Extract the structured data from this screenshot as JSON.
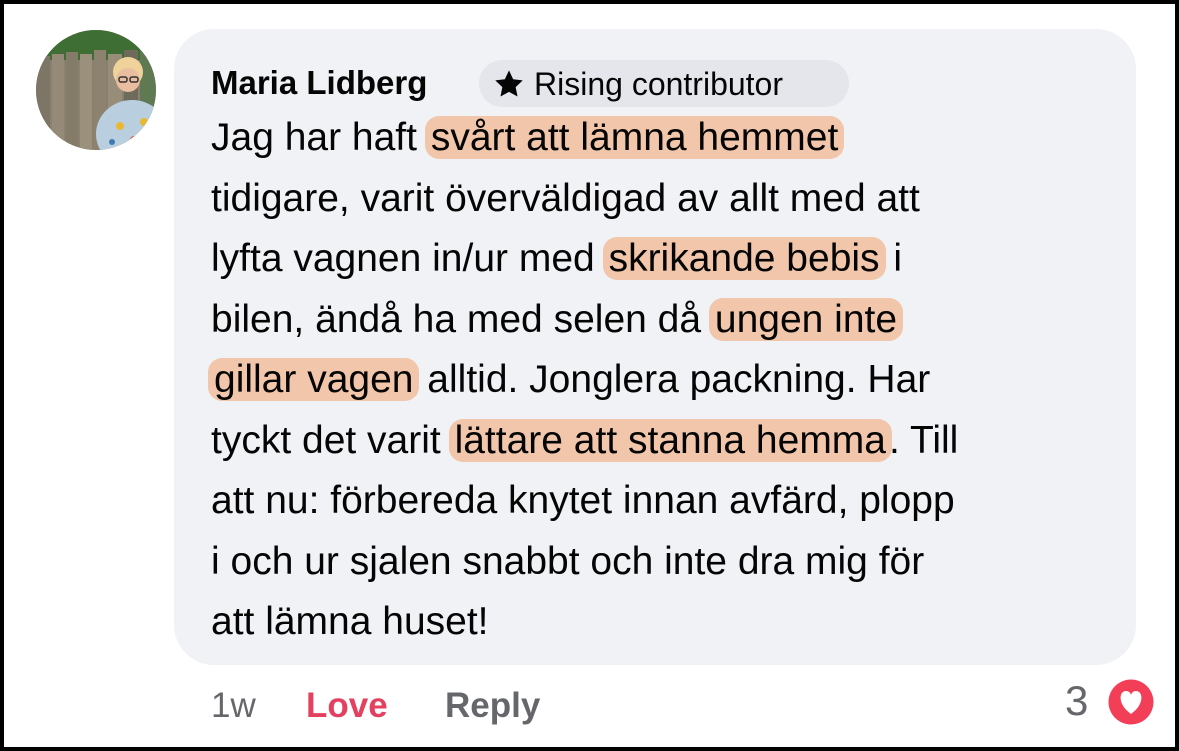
{
  "comment": {
    "author": "Maria Lidberg",
    "badge": {
      "icon": "star-icon",
      "label": "Rising contributor"
    },
    "lines": [
      {
        "segments": [
          {
            "text": "Jag har haft ",
            "highlight": false
          },
          {
            "text": "svårt att lämna hemmet",
            "highlight": true
          }
        ]
      },
      {
        "segments": [
          {
            "text": "tidigare, varit överväldigad av allt med att",
            "highlight": false
          }
        ]
      },
      {
        "segments": [
          {
            "text": "lyfta vagnen in/ur med ",
            "highlight": false
          },
          {
            "text": "skrikande bebis",
            "highlight": true
          },
          {
            "text": " i",
            "highlight": false
          }
        ]
      },
      {
        "segments": [
          {
            "text": "bilen, ändå ha med selen då ",
            "highlight": false
          },
          {
            "text": "ungen inte",
            "highlight": true
          }
        ]
      },
      {
        "segments": [
          {
            "text": "gillar vagen",
            "highlight": true
          },
          {
            "text": " alltid. Jonglera packning. Har",
            "highlight": false
          }
        ]
      },
      {
        "segments": [
          {
            "text": "tyckt det varit ",
            "highlight": false
          },
          {
            "text": "lättare att stanna hemma",
            "highlight": true
          },
          {
            "text": ". Till",
            "highlight": false
          }
        ]
      },
      {
        "segments": [
          {
            "text": "att nu: förbereda knytet innan avfärd, plopp",
            "highlight": false
          }
        ]
      },
      {
        "segments": [
          {
            "text": "i och ur sjalen snabbt och inte dra mig för",
            "highlight": false
          }
        ]
      },
      {
        "segments": [
          {
            "text": "att lämna huset!",
            "highlight": false
          }
        ]
      }
    ],
    "highlight_color": "#f2a26e",
    "bubble_color": "#f0f2f5"
  },
  "actions": {
    "time": "1w",
    "love_label": "Love",
    "reply_label": "Reply",
    "love_color": "#e4405f"
  },
  "reactions": {
    "count": "3",
    "icon": "heart-icon",
    "color": "#f33e58"
  }
}
